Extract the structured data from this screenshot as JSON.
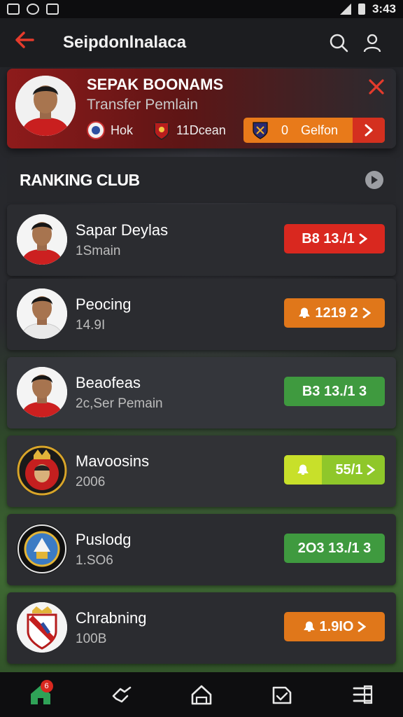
{
  "status_bar": {
    "time": "3:43"
  },
  "app_bar": {
    "title": "Seipdonlnalaca"
  },
  "hero": {
    "name": "SEPAK BOONAMS",
    "subtitle": "Transfer Pemlain",
    "team1": "Hok",
    "team2": "11Dcean",
    "button_icon_text": "0",
    "button_label": "Gelfon"
  },
  "ranking": {
    "title": "RANKING CLUB",
    "rows": [
      {
        "name": "Sapar Deylas",
        "sub": "1Smain",
        "value": "B8 13./1",
        "color": "#d9281f",
        "icon": "none",
        "avatar": "player-red"
      },
      {
        "name": "Peocing",
        "sub": "14.9I",
        "value": "1219 2",
        "color": "#e0771a",
        "icon": "bell",
        "avatar": "player-white"
      },
      {
        "name": "Beaofeas",
        "sub": "2c,Ser Pemain",
        "value": "B3 13./1 3",
        "color": "#3f9a3f",
        "icon": "none",
        "avatar": "player-red"
      },
      {
        "name": "Mavoosins",
        "sub": "2006",
        "value": "55/1",
        "color": "#8fc72a",
        "icon": "bell",
        "avatar": "crest-red"
      },
      {
        "name": "Puslodg",
        "sub": "1.SO6",
        "value": "2O3 13./1 3",
        "color": "#3f9a3f",
        "icon": "none",
        "avatar": "crest-blue"
      },
      {
        "name": "Chrabning",
        "sub": "100B",
        "value": "1.9IO",
        "color": "#e0771a",
        "icon": "bell",
        "avatar": "crest-white"
      }
    ]
  },
  "bottom_nav": {
    "badge": "6"
  },
  "colors": {
    "accent": "#e53b2c",
    "orange": "#e87a1a",
    "green": "#3f9a3f",
    "lime": "#8fc72a"
  }
}
